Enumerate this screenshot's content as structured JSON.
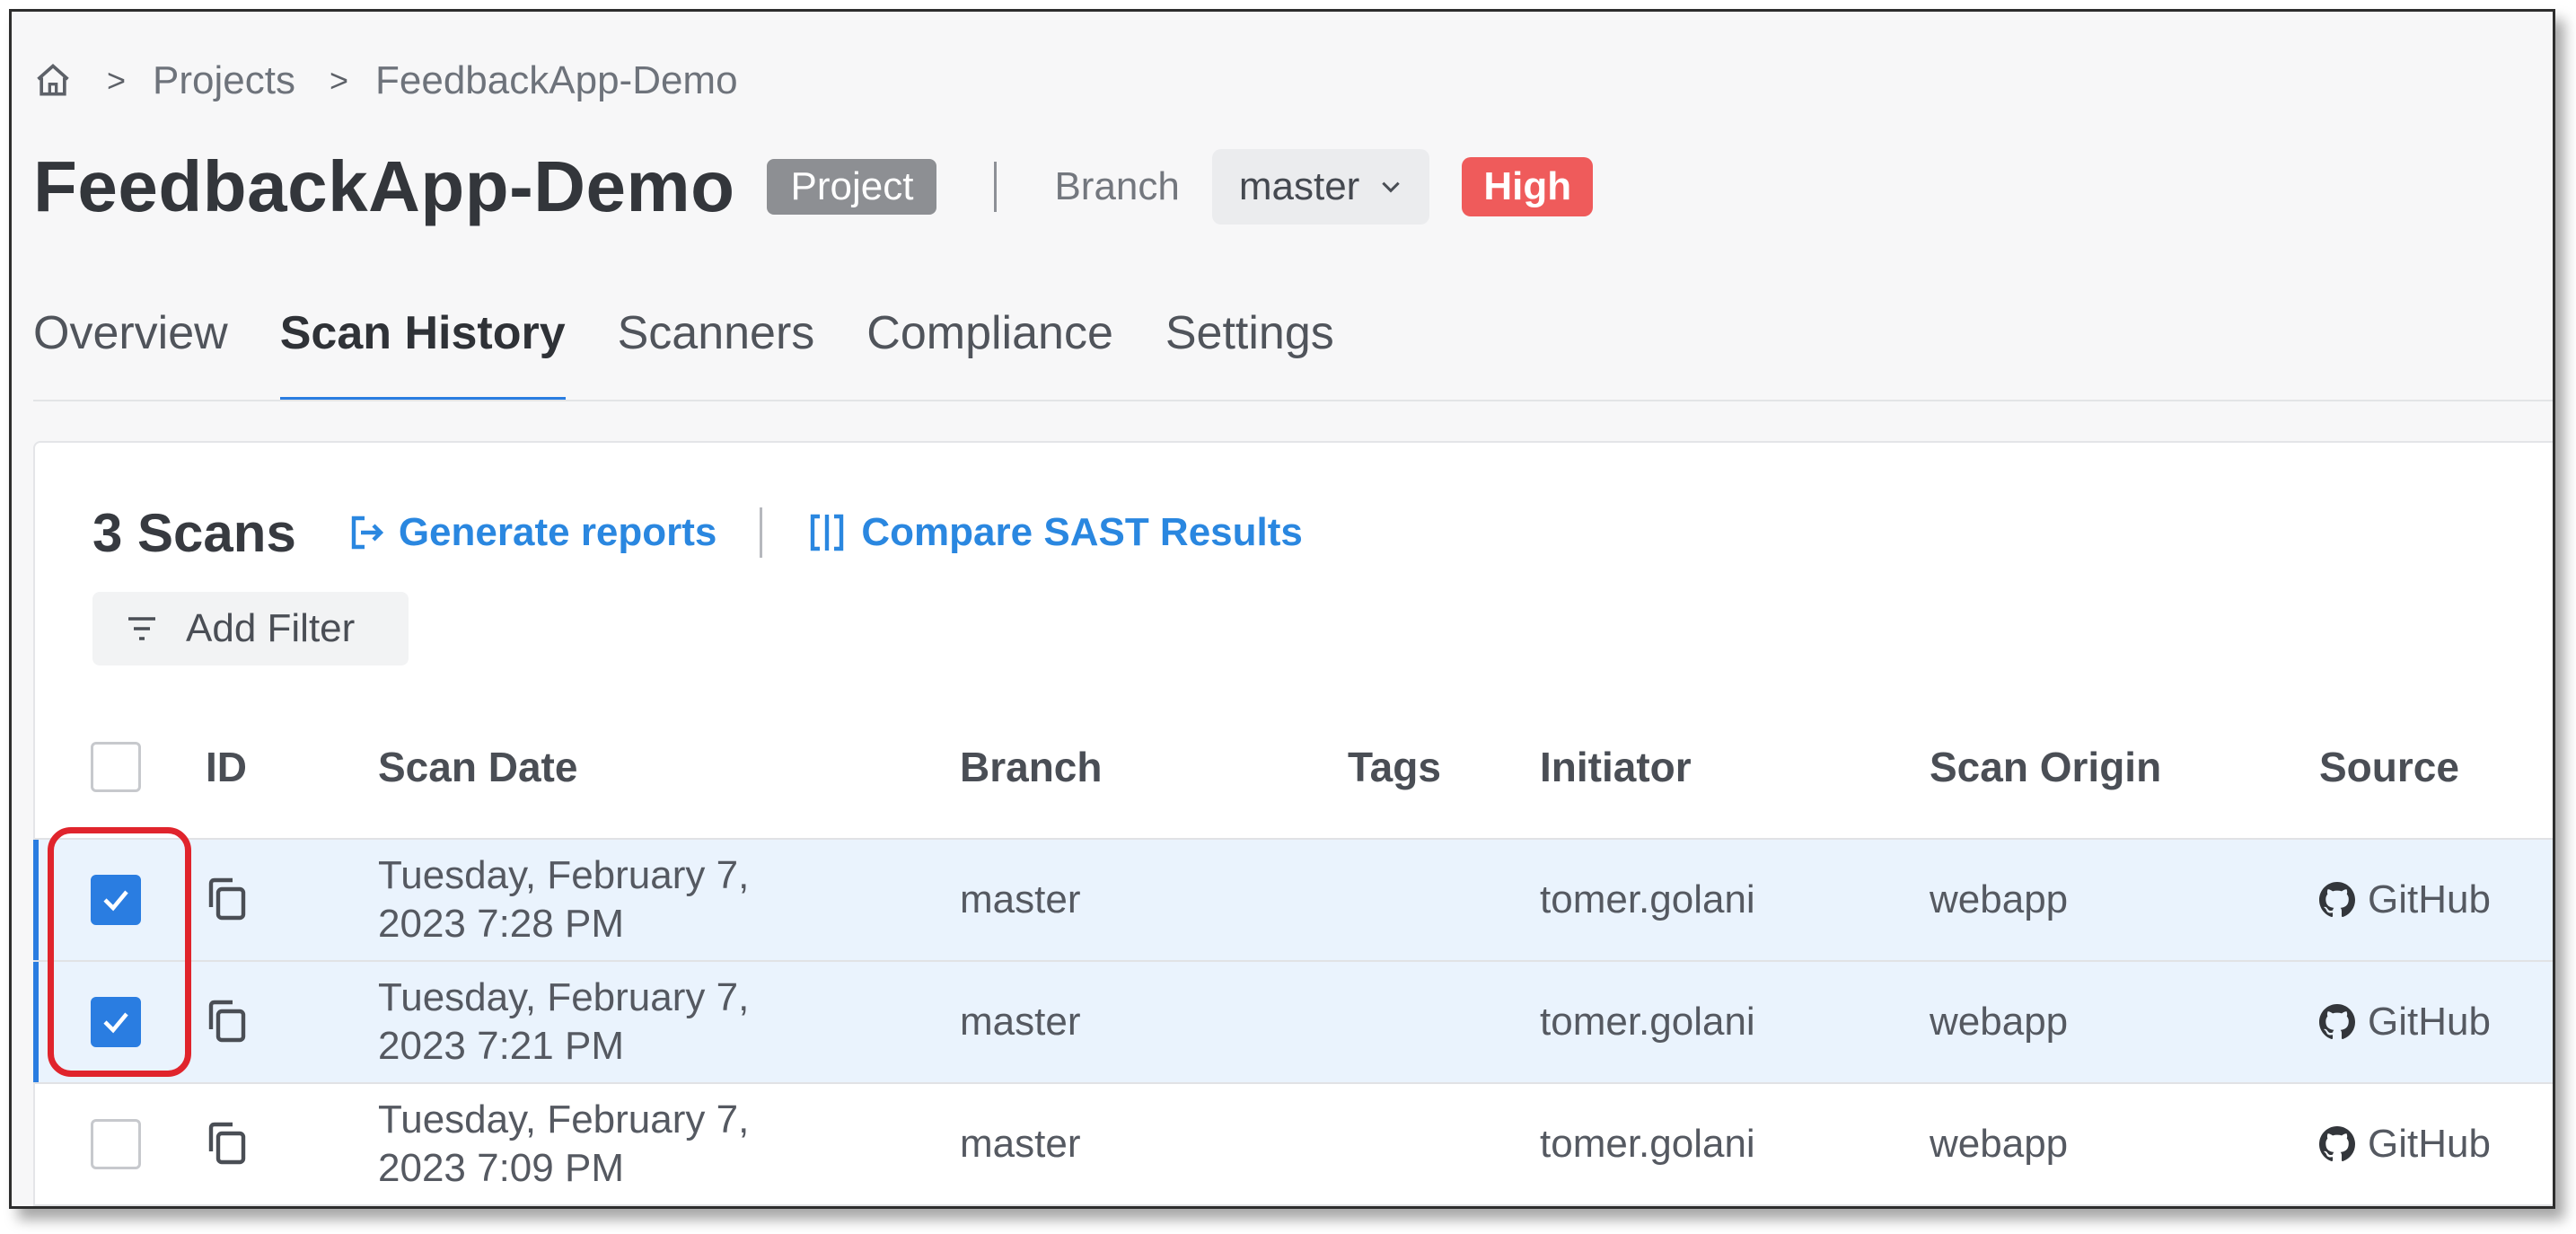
{
  "breadcrumb": {
    "home_icon": "home-icon",
    "items": [
      "Projects",
      "FeedbackApp-Demo"
    ]
  },
  "header": {
    "title": "FeedbackApp-Demo",
    "type_badge": "Project",
    "branch_label": "Branch",
    "branch_value": "master",
    "risk_badge": "High"
  },
  "tabs": [
    {
      "label": "Overview",
      "active": false
    },
    {
      "label": "Scan History",
      "active": true
    },
    {
      "label": "Scanners",
      "active": false
    },
    {
      "label": "Compliance",
      "active": false
    },
    {
      "label": "Settings",
      "active": false
    }
  ],
  "scans": {
    "count_label": "3 Scans",
    "generate_reports": "Generate reports",
    "compare_sast": "Compare SAST Results",
    "add_filter": "Add Filter"
  },
  "table": {
    "columns": [
      "ID",
      "Scan Date",
      "Branch",
      "Tags",
      "Initiator",
      "Scan Origin",
      "Source"
    ],
    "rows": [
      {
        "selected": true,
        "date_line1": "Tuesday, February 7,",
        "date_line2": "2023 7:28 PM",
        "branch": "master",
        "tags": "",
        "initiator": "tomer.golani",
        "origin": "webapp",
        "source": "GitHub"
      },
      {
        "selected": true,
        "date_line1": "Tuesday, February 7,",
        "date_line2": "2023 7:21 PM",
        "branch": "master",
        "tags": "",
        "initiator": "tomer.golani",
        "origin": "webapp",
        "source": "GitHub"
      },
      {
        "selected": false,
        "date_line1": "Tuesday, February 7,",
        "date_line2": "2023 7:09 PM",
        "branch": "master",
        "tags": "",
        "initiator": "tomer.golani",
        "origin": "webapp",
        "source": "GitHub"
      }
    ]
  },
  "colors": {
    "accent": "#2a7de1",
    "link": "#2a87e0",
    "risk_high": "#ef5b5b",
    "annotation": "#e0242c",
    "selected_row": "#eaf3fd"
  }
}
